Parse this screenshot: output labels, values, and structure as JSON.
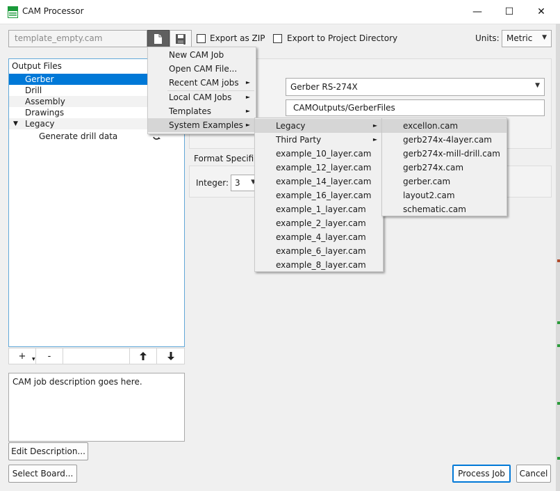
{
  "window": {
    "title": "CAM Processor",
    "minimize": "—",
    "maximize": "☐",
    "close": "✕"
  },
  "toolbar": {
    "job_name_placeholder": "template_empty.cam",
    "export_zip_label": "Export as ZIP",
    "export_zip_checked": false,
    "export_project_label": "Export to Project Directory",
    "export_project_checked": false,
    "units_label": "Units:",
    "units_value": "Metric"
  },
  "output_files": {
    "header": "Output Files",
    "items": [
      {
        "label": "Gerber",
        "selected": true
      },
      {
        "label": "Drill"
      },
      {
        "label": "Assembly"
      },
      {
        "label": "Drawings"
      },
      {
        "label": "Legacy",
        "expanded": true
      },
      {
        "label": "Generate drill data"
      }
    ],
    "toolbar": {
      "add": "+",
      "remove": "-",
      "up": "🡑",
      "down": "🡓"
    }
  },
  "description": {
    "text": "CAM job description goes here.",
    "edit_button": "Edit Description..."
  },
  "footer": {
    "select_board": "Select Board...",
    "process_job": "Process Job",
    "cancel": "Cancel"
  },
  "output_settings": {
    "format_value": "Gerber RS-274X",
    "path_value": "CAMOutputs/GerberFiles",
    "format_spec_title": "Format Specifier",
    "integer_label": "Integer:",
    "integer_value": "3"
  },
  "menu_main": {
    "items": [
      {
        "label": "New CAM Job"
      },
      {
        "label": "Open CAM File..."
      },
      {
        "label": "Recent CAM jobs",
        "submenu": true
      },
      {
        "label": "Local CAM Jobs",
        "submenu": true
      },
      {
        "label": "Templates",
        "submenu": true
      },
      {
        "label": "System Examples",
        "submenu": true,
        "highlighted": true
      }
    ]
  },
  "menu_examples": {
    "items": [
      {
        "label": "Legacy",
        "submenu": true,
        "highlighted": true
      },
      {
        "label": "Third Party",
        "submenu": true
      },
      {
        "label": "example_10_layer.cam"
      },
      {
        "label": "example_12_layer.cam"
      },
      {
        "label": "example_14_layer.cam"
      },
      {
        "label": "example_16_layer.cam"
      },
      {
        "label": "example_1_layer.cam"
      },
      {
        "label": "example_2_layer.cam"
      },
      {
        "label": "example_4_layer.cam"
      },
      {
        "label": "example_6_layer.cam"
      },
      {
        "label": "example_8_layer.cam"
      }
    ]
  },
  "menu_legacy": {
    "items": [
      {
        "label": "excellon.cam",
        "highlighted": true
      },
      {
        "label": "gerb274x-4layer.cam"
      },
      {
        "label": "gerb274x-mill-drill.cam"
      },
      {
        "label": "gerb274x.cam"
      },
      {
        "label": "gerber.cam"
      },
      {
        "label": "layout2.cam"
      },
      {
        "label": "schematic.cam"
      }
    ]
  },
  "colors": {
    "selection": "#0078d7",
    "panel_border": "#62a8d8",
    "menu_highlight": "#d6d6d6"
  }
}
